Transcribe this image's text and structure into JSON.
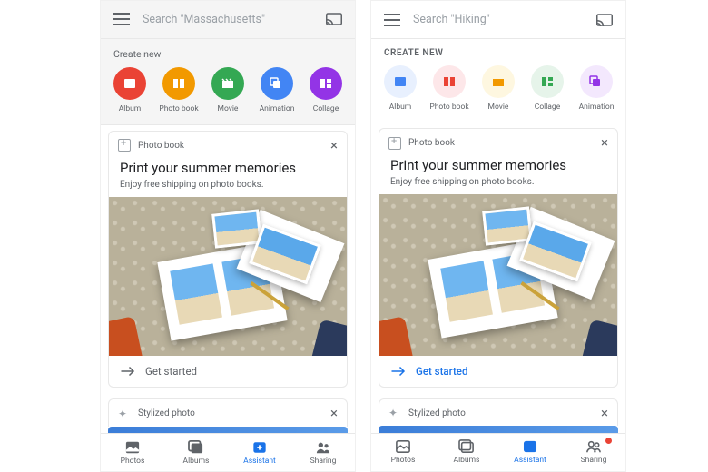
{
  "left": {
    "search_placeholder": "Search \"Massachusetts\"",
    "create_label": "Create new",
    "chips": [
      {
        "label": "Album",
        "bg": "#ea4335"
      },
      {
        "label": "Photo book",
        "bg": "#f29900"
      },
      {
        "label": "Movie",
        "bg": "#34a853"
      },
      {
        "label": "Animation",
        "bg": "#4285f4"
      },
      {
        "label": "Collage",
        "bg": "#9334e6"
      }
    ],
    "card": {
      "tag": "Photo book",
      "title": "Print your summer memories",
      "sub": "Enjoy free shipping on photo books.",
      "action": "Get started"
    },
    "stylized_tag": "Stylized photo",
    "nav": [
      {
        "label": "Photos"
      },
      {
        "label": "Albums"
      },
      {
        "label": "Assistant"
      },
      {
        "label": "Sharing"
      }
    ]
  },
  "right": {
    "search_placeholder": "Search \"Hiking\"",
    "create_label": "CREATE NEW",
    "chips": [
      {
        "label": "Album",
        "bg": "#e8f0fe"
      },
      {
        "label": "Photo book",
        "bg": "#fde7e9"
      },
      {
        "label": "Movie",
        "bg": "#fef7e0"
      },
      {
        "label": "Collage",
        "bg": "#e6f4ea"
      },
      {
        "label": "Animation",
        "bg": "#f3e8fd"
      }
    ],
    "chip_icon_colors": [
      "#4285f4",
      "#ea4335",
      "#f29900",
      "#34a853",
      "#9334e6"
    ],
    "card": {
      "tag": "Photo book",
      "title": "Print your summer memories",
      "sub": "Enjoy free shipping on photo books.",
      "action": "Get started"
    },
    "stylized_tag": "Stylized photo",
    "nav": [
      {
        "label": "Photos"
      },
      {
        "label": "Albums"
      },
      {
        "label": "Assistant"
      },
      {
        "label": "Sharing"
      }
    ],
    "sharing_badge": true
  }
}
